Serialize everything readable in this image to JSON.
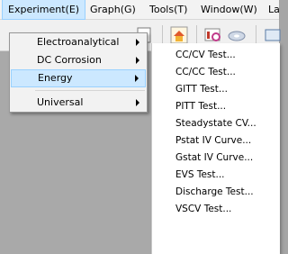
{
  "menubar": {
    "items": [
      "Experiment(E)",
      "Graph(G)",
      "Tools(T)",
      "Window(W)",
      "La"
    ]
  },
  "experiment_menu": {
    "items": [
      {
        "label": "Electroanalytical",
        "has_submenu": true
      },
      {
        "label": "DC Corrosion",
        "has_submenu": true
      },
      {
        "label": "Energy",
        "has_submenu": true,
        "highlighted": true
      },
      {
        "label": "Universal",
        "has_submenu": true
      }
    ]
  },
  "energy_submenu": {
    "items": [
      "CC/CV Test...",
      "CC/CC Test...",
      "GITT Test...",
      "PITT Test...",
      "Steadystate CV...",
      "Pstat IV Curve...",
      "Gstat IV Curve...",
      "EVS Test...",
      "Discharge Test...",
      "VSCV Test..."
    ]
  },
  "toolbar": {
    "icons": [
      "document-icon",
      "home-icon",
      "chart-search-icon",
      "disc-icon",
      "window-icon"
    ]
  },
  "colors": {
    "highlight": "#cce8ff",
    "highlight_border": "#99d1ff",
    "workspace": "#a9a9a9"
  }
}
